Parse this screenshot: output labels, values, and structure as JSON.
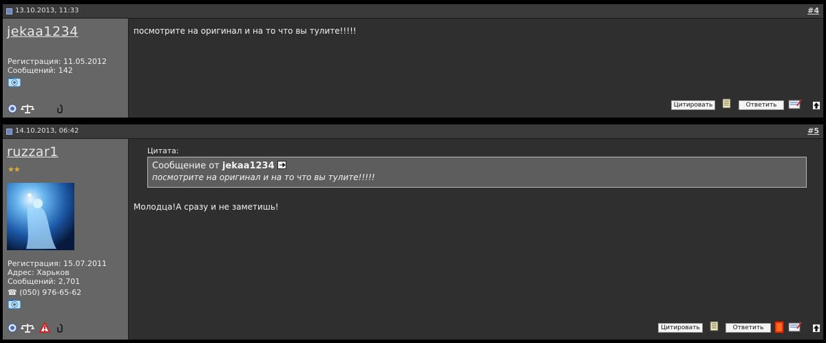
{
  "posts": [
    {
      "date": "13.10.2013, 11:33",
      "number": "#4",
      "username": "jekaa1234",
      "registration": "Регистрация: 11.05.2012",
      "messages": "Сообщений: 142",
      "text": "посмотрите на оригинал и на то что вы тулите!!!!!",
      "quote_button": "Цитировать",
      "reply_button": "Ответить"
    },
    {
      "date": "14.10.2013, 06:42",
      "number": "#5",
      "username": "ruzzar1",
      "stars": "★★",
      "registration": "Регистрация: 15.07.2011",
      "address": "Адрес: Харьков",
      "messages": "Сообщений: 2,701",
      "phone": "☎ (050) 976-65-62",
      "quote_label": "Цитата:",
      "quote_from_prefix": "Сообщение от",
      "quote_author": "jekaa1234",
      "quote_text": "посмотрите на оригинал и на то что вы тулите!!!!!",
      "text": "Молодца!А сразу и не заметишь!",
      "quote_button": "Цитировать",
      "reply_button": "Ответить"
    }
  ],
  "colors": {
    "background": "#000000",
    "header": "#3a3a3a",
    "sidebar": "#666666",
    "content": "#2f2f2f",
    "quote_box": "#5d5d5d"
  }
}
